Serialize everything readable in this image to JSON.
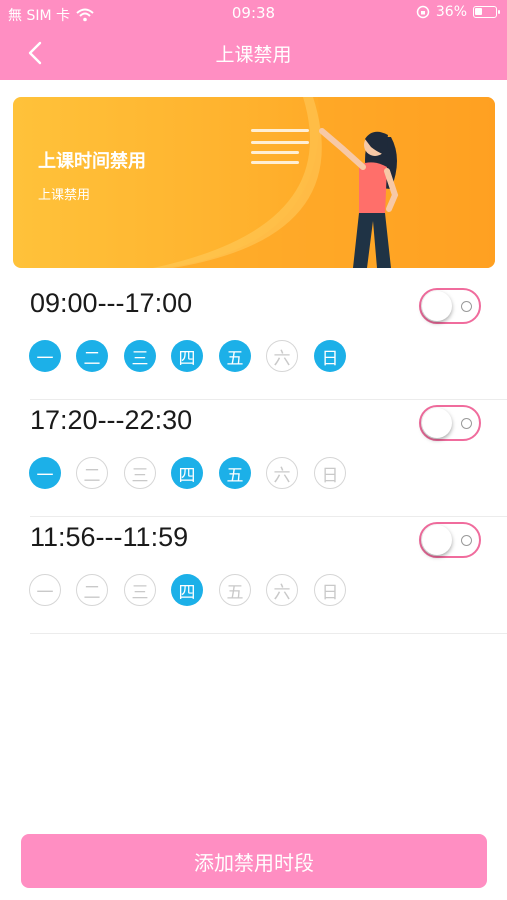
{
  "status_bar": {
    "carrier": "無 SIM 卡",
    "time": "09:38",
    "battery_text": "36%",
    "battery_level": 0.36
  },
  "header": {
    "title": "上课禁用",
    "back_icon": "chevron-left-icon"
  },
  "banner": {
    "title": "上课时间禁用",
    "subtitle": "上课禁用"
  },
  "schedules": [
    {
      "time": "09:00---17:00",
      "enabled": false,
      "days": [
        {
          "label": "一",
          "active": true
        },
        {
          "label": "二",
          "active": true
        },
        {
          "label": "三",
          "active": true
        },
        {
          "label": "四",
          "active": true
        },
        {
          "label": "五",
          "active": true
        },
        {
          "label": "六",
          "active": false
        },
        {
          "label": "日",
          "active": true
        }
      ]
    },
    {
      "time": "17:20---22:30",
      "enabled": false,
      "days": [
        {
          "label": "一",
          "active": true
        },
        {
          "label": "二",
          "active": false
        },
        {
          "label": "三",
          "active": false
        },
        {
          "label": "四",
          "active": true
        },
        {
          "label": "五",
          "active": true
        },
        {
          "label": "六",
          "active": false
        },
        {
          "label": "日",
          "active": false
        }
      ]
    },
    {
      "time": "11:56---11:59",
      "enabled": false,
      "days": [
        {
          "label": "一",
          "active": false
        },
        {
          "label": "二",
          "active": false
        },
        {
          "label": "三",
          "active": false
        },
        {
          "label": "四",
          "active": true
        },
        {
          "label": "五",
          "active": false
        },
        {
          "label": "六",
          "active": false
        },
        {
          "label": "日",
          "active": false
        }
      ]
    }
  ],
  "add_button": {
    "label": "添加禁用时段"
  },
  "colors": {
    "header": "#ff8ec2",
    "day_active": "#1cb0e8",
    "toggle_border": "#f06c9d",
    "banner_start": "#ffc23a",
    "banner_end": "#ff9a1c"
  }
}
